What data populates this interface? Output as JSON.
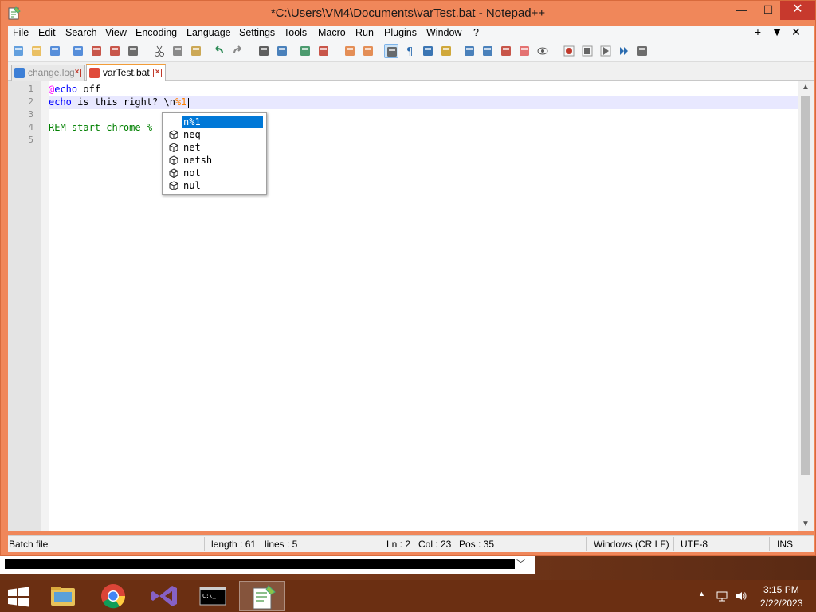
{
  "window": {
    "title": "*C:\\Users\\VM4\\Documents\\varTest.bat - Notepad++",
    "min_glyph": "—",
    "max_glyph": "☐",
    "close_glyph": "✕"
  },
  "menu": {
    "items": [
      "File",
      "Edit",
      "Search",
      "View",
      "Encoding",
      "Language",
      "Settings",
      "Tools",
      "Macro",
      "Run",
      "Plugins",
      "Window",
      "?"
    ],
    "right": [
      "+",
      "▼",
      "✕"
    ]
  },
  "toolbar": {
    "icons": [
      "new-file-icon",
      "open-icon",
      "save-icon",
      "save-all-icon",
      "close-icon",
      "close-all-icon",
      "print-icon",
      "cut-icon",
      "copy-icon",
      "paste-icon",
      "undo-icon",
      "redo-icon",
      "find-icon",
      "replace-icon",
      "zoom-in-icon",
      "zoom-out-icon",
      "sync-vertical-icon",
      "sync-horizontal-icon",
      "word-wrap-icon",
      "show-all-chars-icon",
      "indent-guide-icon",
      "user-language-icon",
      "doc-map-icon",
      "doc-list-icon",
      "function-list-icon",
      "folder-workspace-icon",
      "monitoring-icon",
      "record-macro-icon",
      "stop-macro-icon",
      "play-macro-icon",
      "run-macro-multiple-icon",
      "save-macro-icon"
    ]
  },
  "tabs": [
    {
      "label": "change.log",
      "active": false
    },
    {
      "label": "varTest.bat",
      "active": true
    }
  ],
  "editor": {
    "line_numbers": [
      "1",
      "2",
      "3",
      "4",
      "5"
    ],
    "lines": [
      {
        "at": "@",
        "kw": "echo",
        "rest": " off"
      },
      {
        "kw": "echo",
        "rest": " is this right? \\n",
        "var": "%1"
      },
      {
        "text": ""
      },
      {
        "rem": "REM start chrome %"
      },
      {
        "text": ""
      }
    ]
  },
  "autocomplete": {
    "items": [
      {
        "label": "n%1",
        "selected": true,
        "icon": false
      },
      {
        "label": "neq",
        "selected": false,
        "icon": true
      },
      {
        "label": "net",
        "selected": false,
        "icon": true
      },
      {
        "label": "netsh",
        "selected": false,
        "icon": true
      },
      {
        "label": "not",
        "selected": false,
        "icon": true
      },
      {
        "label": "nul",
        "selected": false,
        "icon": true
      }
    ]
  },
  "status": {
    "file_type": "Batch file",
    "length": "length : 61",
    "lines": "lines : 5",
    "ln": "Ln : 2",
    "col": "Col : 23",
    "pos": "Pos : 35",
    "eol": "Windows (CR LF)",
    "encoding": "UTF-8",
    "mode": "INS"
  },
  "taskbar": {
    "apps": [
      "file-explorer",
      "chrome",
      "visual-studio",
      "command-prompt",
      "notepad-plus-plus"
    ],
    "time": "3:15 PM",
    "date": "2/22/2023"
  },
  "colors": {
    "window_frame": "#f0875a",
    "keyword": "#0000ff",
    "variable": "#ff8000",
    "comment": "#008000",
    "selection": "#0078d7",
    "taskbar": "#6b2f12"
  }
}
